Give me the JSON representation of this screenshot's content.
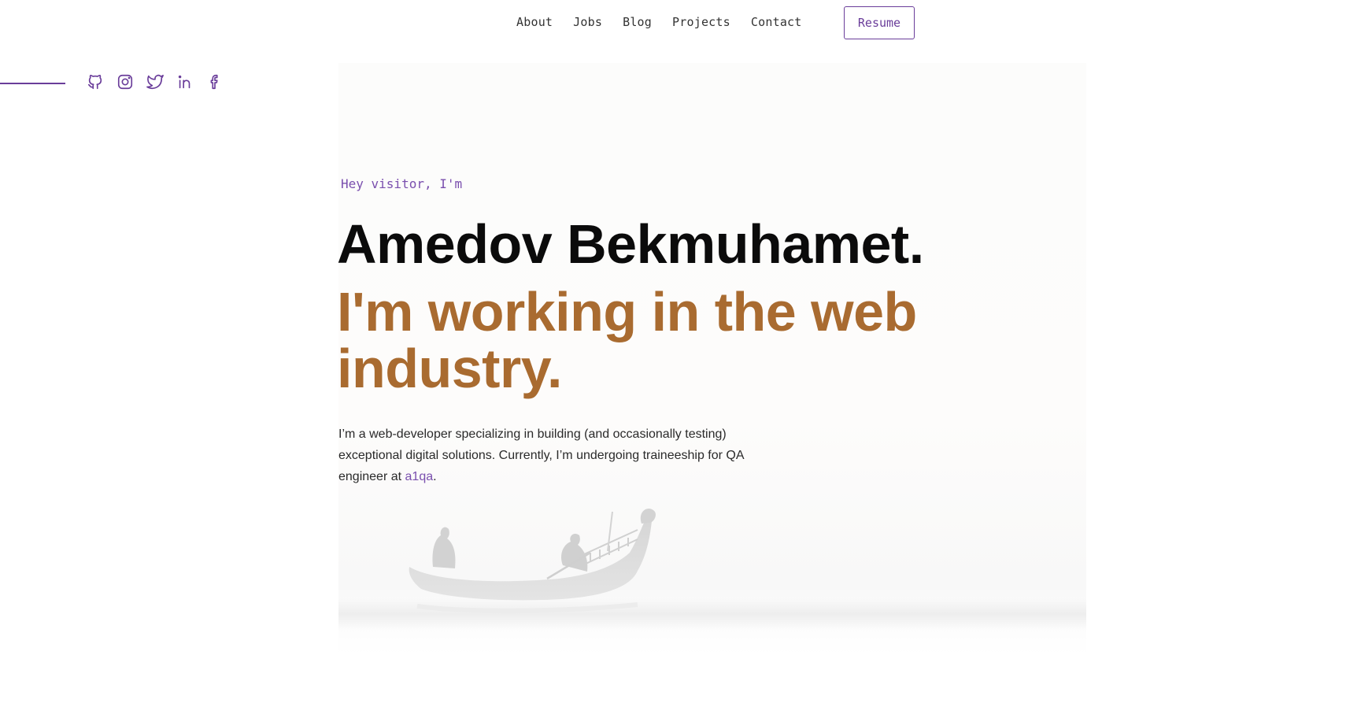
{
  "nav": {
    "links": [
      {
        "label": "About"
      },
      {
        "label": "Jobs"
      },
      {
        "label": "Blog"
      },
      {
        "label": "Projects"
      },
      {
        "label": "Contact"
      }
    ],
    "resume_label": "Resume"
  },
  "social": {
    "icons": [
      "github-icon",
      "instagram-icon",
      "twitter-icon",
      "linkedin-icon",
      "facebook-icon"
    ]
  },
  "hero": {
    "greeting": "Hey visitor, I'm",
    "name": "Amedov Bekmuhamet.",
    "tagline": "I'm working in the web industry.",
    "bio_text": "I’m a web-developer specializing in building (and occasionally testing) exceptional digital solutions. Currently, I’m undergoing traineeship for QA engineer at ",
    "bio_link": "a1qa",
    "bio_end": "."
  },
  "colors": {
    "accent": "#6a3d9a",
    "tagline": "#a96b30",
    "name": "#0b0b0b"
  }
}
